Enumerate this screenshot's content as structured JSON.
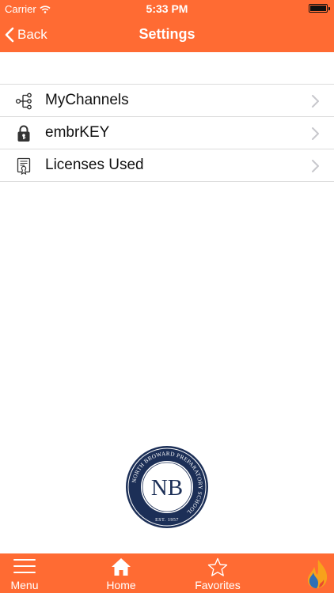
{
  "status_bar": {
    "carrier": "Carrier",
    "time": "5:33 PM"
  },
  "nav": {
    "back_label": "Back",
    "title": "Settings"
  },
  "settings": {
    "items": [
      {
        "label": "MyChannels",
        "icon": "channels-tree-icon"
      },
      {
        "label": "embrKEY",
        "icon": "lock-key-icon"
      },
      {
        "label": "Licenses Used",
        "icon": "certificate-icon"
      }
    ]
  },
  "logo": {
    "ring_text": "NORTH BROWARD PREPARATORY SCHOOL",
    "initials": "NB",
    "est": "EST. 1957"
  },
  "tabbar": {
    "menu_label": "Menu",
    "home_label": "Home",
    "favorites_label": "Favorites"
  },
  "colors": {
    "accent": "#ff6b33",
    "logo_navy": "#1c2f57"
  }
}
